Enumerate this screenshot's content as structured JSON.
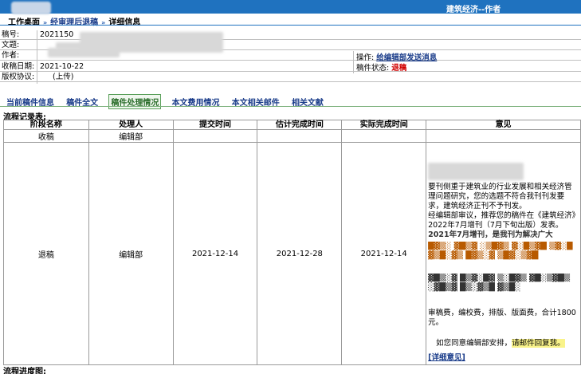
{
  "header": {
    "title": "建筑经济--作者"
  },
  "breadcrumb": {
    "home": "工作桌面",
    "mid": "经审理后退稿",
    "current": "详细信息"
  },
  "info": {
    "id_label": "稿号:",
    "id_value": "2021150",
    "title_label": "文题:",
    "author_label": "作者:",
    "date_label": "收稿日期:",
    "date_value": "2021-10-22",
    "copyright_label": "版权协议:",
    "copyright_value": "(上传)",
    "op_label": "操作:",
    "op_link": "给编辑部发送消息",
    "status_label": "稿件状态:",
    "status_value": "退稿"
  },
  "tabs": [
    "当前稿件信息",
    "稿件全文",
    "稿件处理情况",
    "本文费用情况",
    "本文相关邮件",
    "相关文献"
  ],
  "flow": {
    "title": "流程记录表:",
    "headers": [
      "阶段名称",
      "处理人",
      "提交时间",
      "估计完成时间",
      "实际完成时间",
      "意见"
    ],
    "rows": [
      {
        "stage": "收稿",
        "handler": "编辑部",
        "submit": "",
        "est": "",
        "actual": ""
      },
      {
        "stage": "退稿",
        "handler": "编辑部",
        "submit": "2021-12-14",
        "est": "2021-12-28",
        "actual": "2021-12-14"
      }
    ],
    "opinion": {
      "p1": "要刊侧重于建筑业的行业发展和相关经济管理问题研究，您的选题不符合我刊刊发要求，建筑经济正刊不予刊发。",
      "p2": "经编辑部审议，推荐您的稿件在《建筑经济》2022年7月增刊（7月下旬出版）发表。",
      "p3": "2021年7月增刊，是我刊为解决广大",
      "p4": "审稿费，编校费，排版、版面费，合计1800元。",
      "p5_a": "如您同意编辑部安排，",
      "p5_b": "请邮件回复我。",
      "more": "[详细意见]"
    }
  },
  "progress_title": "流程进度图:"
}
